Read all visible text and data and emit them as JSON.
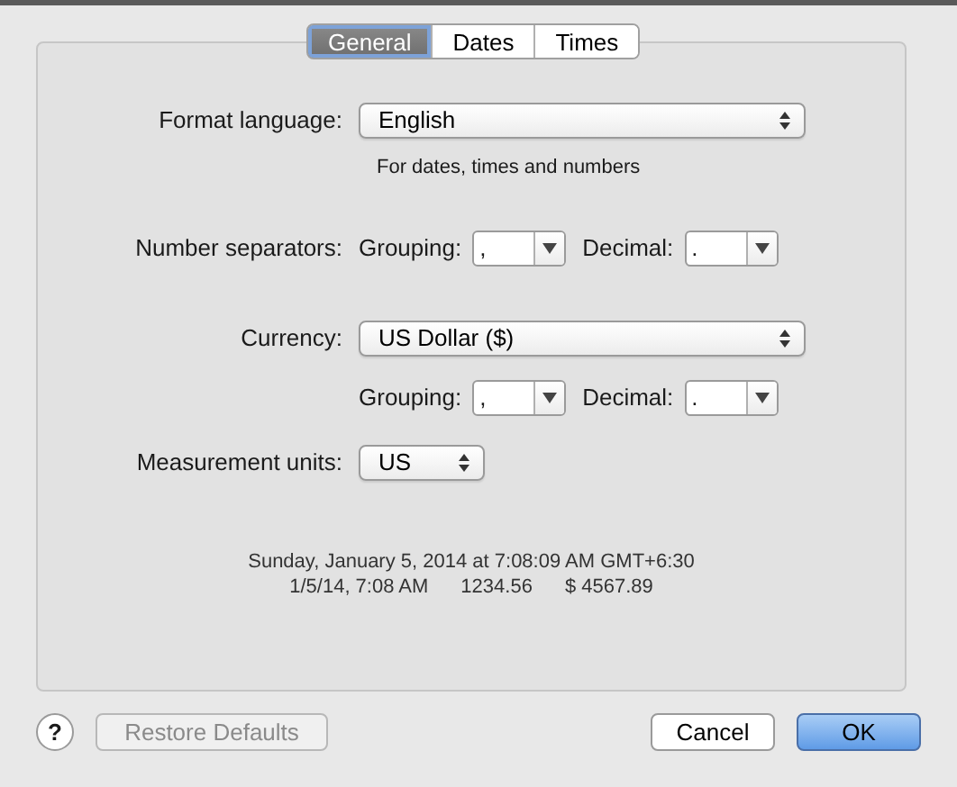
{
  "tabs": [
    {
      "label": "General",
      "selected": true
    },
    {
      "label": "Dates",
      "selected": false
    },
    {
      "label": "Times",
      "selected": false
    }
  ],
  "format_language": {
    "label": "Format language:",
    "value": "English",
    "hint": "For dates, times and numbers"
  },
  "number_separators": {
    "label": "Number separators:",
    "grouping_label": "Grouping:",
    "grouping": ",",
    "decimal_label": "Decimal:",
    "decimal": "."
  },
  "currency": {
    "label": "Currency:",
    "value": "US Dollar ($)",
    "grouping_label": "Grouping:",
    "grouping": ",",
    "decimal_label": "Decimal:",
    "decimal": "."
  },
  "measurement_units": {
    "label": "Measurement units:",
    "value": "US"
  },
  "sample": [
    "Sunday, January 5, 2014 at 7:08:09 AM GMT+6:30",
    "1/5/14, 7:08 AM",
    "1234.56",
    "$ 4567.89"
  ],
  "help_button": "?",
  "buttons": [
    {
      "label": "Restore Defaults",
      "kind": "secondary",
      "disabled": true
    },
    {
      "label": "Cancel",
      "kind": "secondary",
      "disabled": false
    },
    {
      "label": "OK",
      "kind": "default",
      "disabled": false
    }
  ]
}
